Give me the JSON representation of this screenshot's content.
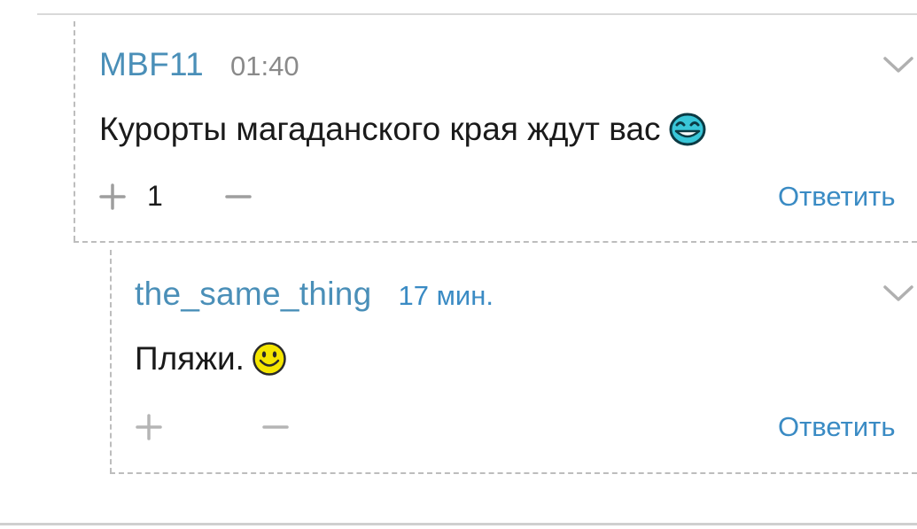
{
  "comments": [
    {
      "username": "MBF11",
      "time": "01:40",
      "text": "Курорты магаданского края ждут вас",
      "emoji_icon": "grinning-face-icon",
      "rating": "1",
      "reply_label": "Ответить"
    },
    {
      "username": "the_same_thing",
      "time": "17 мин.",
      "text": "Пляжи.",
      "emoji_icon": "smiley-face-icon",
      "rating": "",
      "reply_label": "Ответить"
    }
  ],
  "colors": {
    "username": "#4a8fb8",
    "link": "#3a8bc4",
    "timestamp_gray": "#8a8a8a",
    "text": "#1a1a1a",
    "dashed_border": "#bdbdbd",
    "vote_icon": "#9e9e9e"
  }
}
